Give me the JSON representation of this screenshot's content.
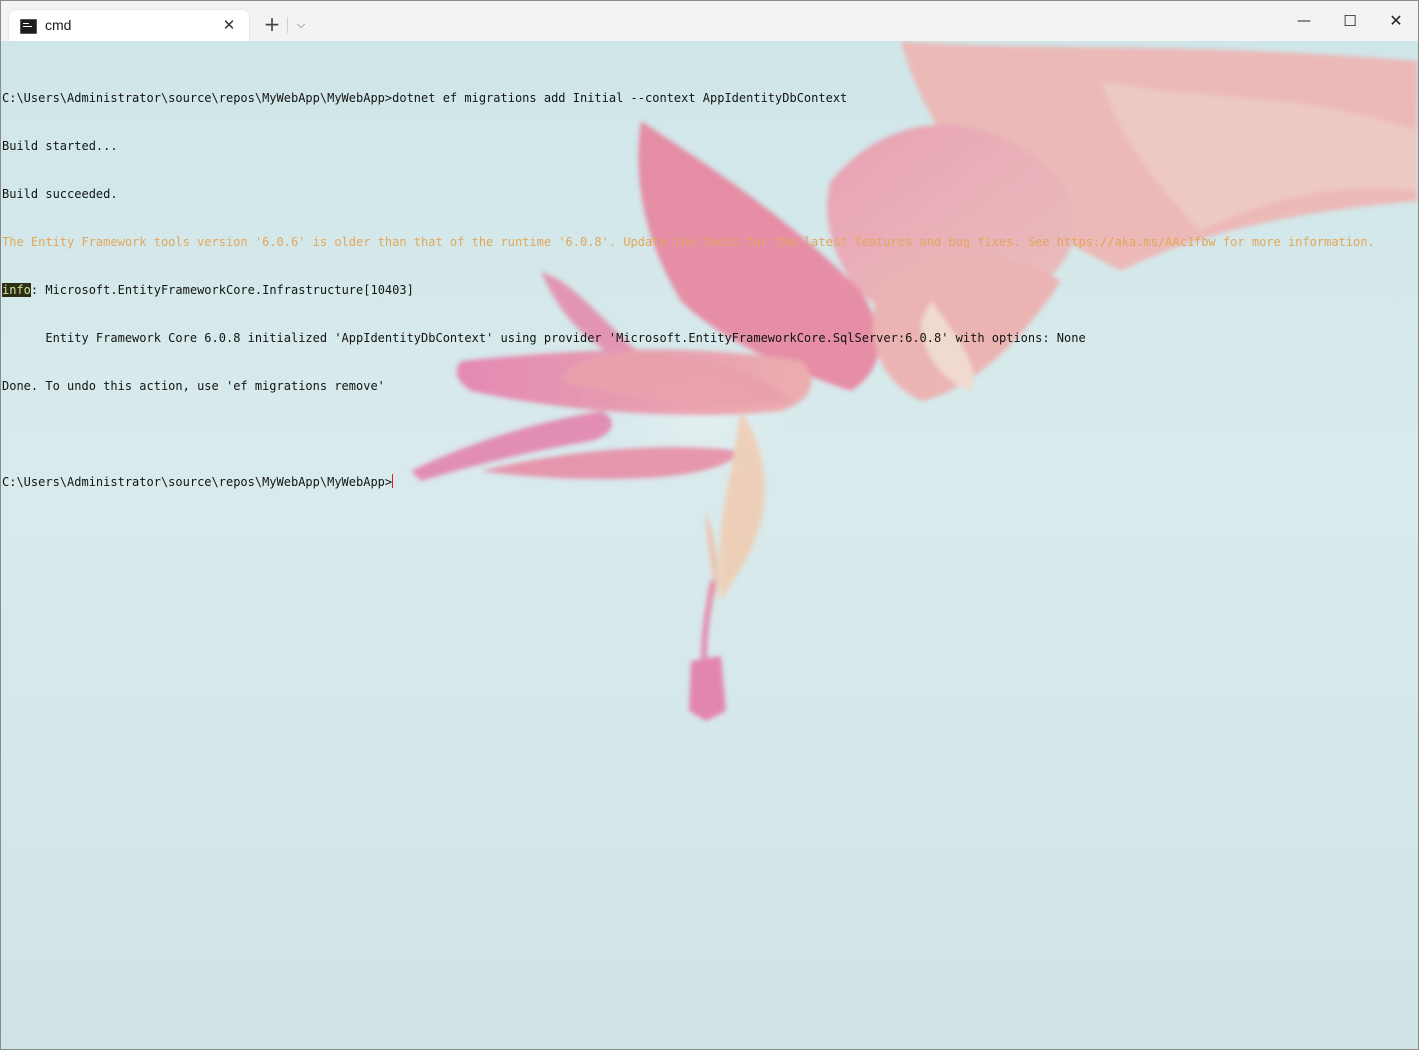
{
  "titlebar": {
    "tab_title": "cmd",
    "tab_close": "✕",
    "new_tab": "+",
    "dropdown": "⌵",
    "minimize": "—",
    "maximize": "☐",
    "close": "✕"
  },
  "icons": {
    "tab": "cmd-icon",
    "close": "close-icon",
    "add": "plus-icon",
    "dropdown": "chevron-down-icon",
    "minimize": "minimize-icon",
    "maximize": "maximize-icon",
    "window_close": "close-icon"
  },
  "terminal": {
    "lines": {
      "l0": "C:\\Users\\Administrator\\source\\repos\\MyWebApp\\MyWebApp>dotnet ef migrations add Initial --context AppIdentityDbContext",
      "l1": "Build started...",
      "l2": "Build succeeded.",
      "l3": "The Entity Framework tools version '6.0.6' is older than that of the runtime '6.0.8'. Update the tools for the latest features and bug fixes. See https://aka.ms/AAc1fbw for more information.",
      "l4_tag": "info",
      "l4_rest": ": Microsoft.EntityFrameworkCore.Infrastructure[10403]",
      "l5": "      Entity Framework Core 6.0.8 initialized 'AppIdentityDbContext' using provider 'Microsoft.EntityFrameworkCore.SqlServer:6.0.8' with options: None",
      "l6": "Done. To undo this action, use 'ef migrations remove'",
      "l7": "",
      "l8": "C:\\Users\\Administrator\\source\\repos\\MyWebApp\\MyWebApp>"
    },
    "colors": {
      "text": "#141414",
      "warning": "#e3a75b",
      "info_tag_bg": "#2e2e14",
      "info_tag_fg": "#c9e5a0",
      "cursor": "#e02020"
    }
  }
}
